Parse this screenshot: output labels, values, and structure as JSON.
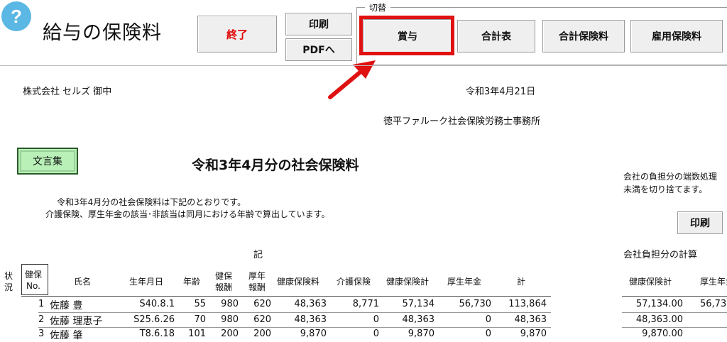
{
  "header": {
    "help_symbol": "?",
    "title": "給与の保険料",
    "buttons": {
      "exit": "終了",
      "print": "印刷",
      "pdf": "PDFへ",
      "bonus": "賞与",
      "total_table": "合計表",
      "total_insurance": "合計保険料",
      "employment_insurance": "雇用保険料"
    },
    "switch_group_label": "切替"
  },
  "document": {
    "company": "株式会社 セルズ 御中",
    "date": "令和3年4月21日",
    "office": "徳平ファルーク社会保険労務士事務所",
    "phrasebook_button": "文言集",
    "title": "令和3年4月分の社会保険料",
    "note_line1": "令和3年4月分の社会保険料は下記のとおりです。",
    "note_line2": "介護保険、厚生年金の該当･非該当は同月における年齢で算出しています。",
    "ki": "記"
  },
  "table": {
    "headers": {
      "status_1": "状",
      "status_2": "況",
      "no_1": "健保",
      "no_2": "No.",
      "name": "氏名",
      "birth": "生年月日",
      "age": "年齢",
      "std_health_1": "健保",
      "std_health_2": "報酬",
      "std_pension_1": "厚年",
      "std_pension_2": "報酬",
      "health": "健康保険料",
      "care": "介護保険",
      "health_total": "健康保険計",
      "pension": "厚生年金",
      "total": "計"
    },
    "rows": [
      {
        "no": "1",
        "name": "佐藤 豊",
        "birth": "S40.8.1",
        "age": "55",
        "sh": "980",
        "sp": "620",
        "health": "48,363",
        "care": "8,771",
        "ht": "57,134",
        "pension": "56,730",
        "total": "113,864"
      },
      {
        "no": "2",
        "name": "佐藤 理恵子",
        "birth": "S25.6.26",
        "age": "70",
        "sh": "980",
        "sp": "620",
        "health": "48,363",
        "care": "0",
        "ht": "48,363",
        "pension": "0",
        "total": "48,363"
      },
      {
        "no": "3",
        "name": "佐藤 肇",
        "birth": "T8.6.18",
        "age": "101",
        "sh": "200",
        "sp": "200",
        "health": "9,870",
        "care": "0",
        "ht": "9,870",
        "pension": "0",
        "total": "9,870"
      }
    ]
  },
  "side": {
    "note_line1": "会社の負担分の端数処理",
    "note_line2": "未満を切り捨てます。",
    "print": "印刷",
    "calc_title": "会社負担分の計算",
    "col_health_total": "健康保険計",
    "col_pension": "厚生年金",
    "rows": [
      {
        "ht": "57,134.00",
        "pension": "56,73"
      },
      {
        "ht": "48,363.00"
      },
      {
        "ht": "9,870.00"
      }
    ]
  },
  "colors": {
    "accent_red": "#e01111",
    "help_blue": "#5bb7e3",
    "phrasebook_green": "#b8f0b8"
  }
}
